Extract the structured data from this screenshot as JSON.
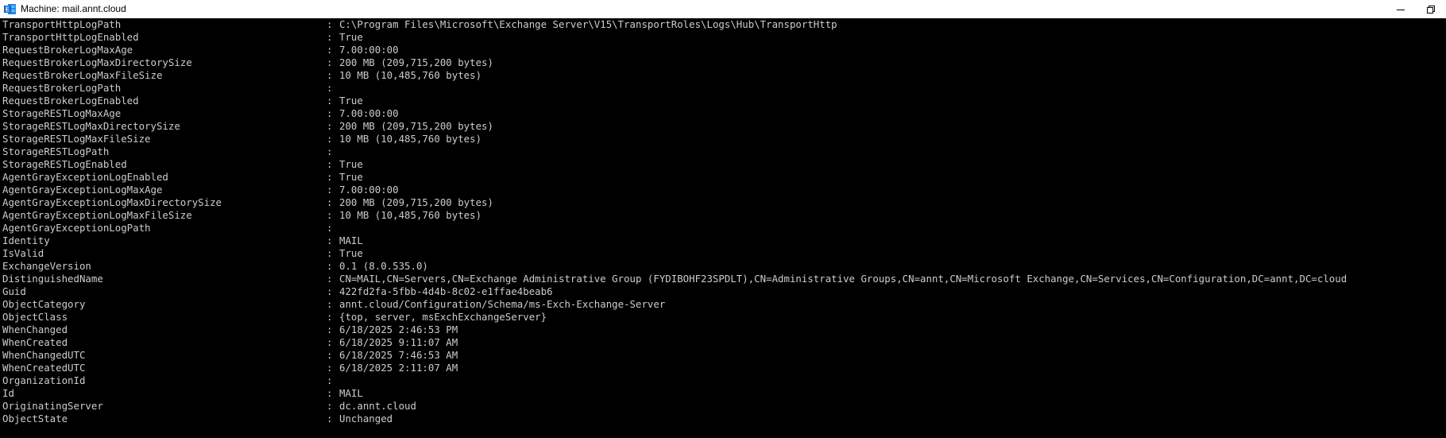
{
  "window": {
    "title": "Machine: mail.annt.cloud",
    "icon": "exchange-app-icon",
    "colors": {
      "titlebar_bg": "#ffffff",
      "console_bg": "#000000",
      "console_fg": "#cccccc",
      "icon_blue": "#0a64c8"
    }
  },
  "console": {
    "separator": ":",
    "rows": [
      {
        "key": "TransportHttpLogPath",
        "value": "C:\\Program Files\\Microsoft\\Exchange Server\\V15\\TransportRoles\\Logs\\Hub\\TransportHttp"
      },
      {
        "key": "TransportHttpLogEnabled",
        "value": "True"
      },
      {
        "key": "RequestBrokerLogMaxAge",
        "value": "7.00:00:00"
      },
      {
        "key": "RequestBrokerLogMaxDirectorySize",
        "value": "200 MB (209,715,200 bytes)"
      },
      {
        "key": "RequestBrokerLogMaxFileSize",
        "value": "10 MB (10,485,760 bytes)"
      },
      {
        "key": "RequestBrokerLogPath",
        "value": ""
      },
      {
        "key": "RequestBrokerLogEnabled",
        "value": "True"
      },
      {
        "key": "StorageRESTLogMaxAge",
        "value": "7.00:00:00"
      },
      {
        "key": "StorageRESTLogMaxDirectorySize",
        "value": "200 MB (209,715,200 bytes)"
      },
      {
        "key": "StorageRESTLogMaxFileSize",
        "value": "10 MB (10,485,760 bytes)"
      },
      {
        "key": "StorageRESTLogPath",
        "value": ""
      },
      {
        "key": "StorageRESTLogEnabled",
        "value": "True"
      },
      {
        "key": "AgentGrayExceptionLogEnabled",
        "value": "True"
      },
      {
        "key": "AgentGrayExceptionLogMaxAge",
        "value": "7.00:00:00"
      },
      {
        "key": "AgentGrayExceptionLogMaxDirectorySize",
        "value": "200 MB (209,715,200 bytes)"
      },
      {
        "key": "AgentGrayExceptionLogMaxFileSize",
        "value": "10 MB (10,485,760 bytes)"
      },
      {
        "key": "AgentGrayExceptionLogPath",
        "value": ""
      },
      {
        "key": "Identity",
        "value": "MAIL"
      },
      {
        "key": "IsValid",
        "value": "True"
      },
      {
        "key": "ExchangeVersion",
        "value": "0.1 (8.0.535.0)"
      },
      {
        "key": "DistinguishedName",
        "value": "CN=MAIL,CN=Servers,CN=Exchange Administrative Group (FYDIBOHF23SPDLT),CN=Administrative Groups,CN=annt,CN=Microsoft Exchange,CN=Services,CN=Configuration,DC=annt,DC=cloud"
      },
      {
        "key": "Guid",
        "value": "422fd2fa-5fbb-4d4b-8c02-e1ffae4beab6"
      },
      {
        "key": "ObjectCategory",
        "value": "annt.cloud/Configuration/Schema/ms-Exch-Exchange-Server"
      },
      {
        "key": "ObjectClass",
        "value": "{top, server, msExchExchangeServer}"
      },
      {
        "key": "WhenChanged",
        "value": "6/18/2025 2:46:53 PM"
      },
      {
        "key": "WhenCreated",
        "value": "6/18/2025 9:11:07 AM"
      },
      {
        "key": "WhenChangedUTC",
        "value": "6/18/2025 7:46:53 AM"
      },
      {
        "key": "WhenCreatedUTC",
        "value": "6/18/2025 2:11:07 AM"
      },
      {
        "key": "OrganizationId",
        "value": ""
      },
      {
        "key": "Id",
        "value": "MAIL"
      },
      {
        "key": "OriginatingServer",
        "value": "dc.annt.cloud"
      },
      {
        "key": "ObjectState",
        "value": "Unchanged"
      }
    ]
  }
}
